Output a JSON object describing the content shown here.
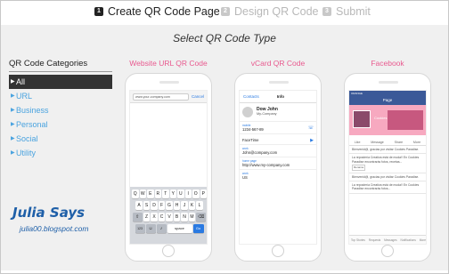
{
  "steps": [
    {
      "num": "1",
      "label": "Create QR Code Page"
    },
    {
      "num": "2",
      "label": "Design QR Code"
    },
    {
      "num": "3",
      "label": "Submit"
    }
  ],
  "page_title": "Select QR Code Type",
  "sidebar": {
    "heading": "QR Code Categories",
    "items": [
      {
        "label": "All"
      },
      {
        "label": "URL"
      },
      {
        "label": "Business"
      },
      {
        "label": "Personal"
      },
      {
        "label": "Social"
      },
      {
        "label": "Utility"
      }
    ]
  },
  "branding": {
    "title": "Julia Says",
    "subtitle": "julia00.blogspot.com"
  },
  "templates": [
    {
      "label": "Website URL QR Code"
    },
    {
      "label": "vCard QR Code"
    },
    {
      "label": "Facebook"
    }
  ],
  "safari": {
    "url": "www.your-company.com",
    "cancel": "Cancel",
    "rows": [
      [
        "Q",
        "W",
        "E",
        "R",
        "T",
        "Y",
        "U",
        "I",
        "O",
        "P"
      ],
      [
        "A",
        "S",
        "D",
        "F",
        "G",
        "H",
        "J",
        "K",
        "L"
      ],
      [
        "Z",
        "X",
        "C",
        "V",
        "B",
        "N",
        "M"
      ]
    ],
    "shift": "⇧",
    "backspace": "⌫",
    "num_key": "123",
    "globe": "☺",
    "mic": "♪",
    "space": "space",
    "slash": "/",
    ".com": ".com",
    "go": "Go"
  },
  "vcard": {
    "nav_back": "Contacts",
    "nav_title": "Info",
    "name": "Dow John",
    "company": "My-Company",
    "fields": [
      {
        "label": "mobile",
        "value": "1234-567-89",
        "icon": "☏"
      },
      {
        "label": "",
        "value": "FaceTime",
        "icon": "▶"
      },
      {
        "label": "work",
        "value": "John@company.com",
        "icon": ""
      },
      {
        "label": "home page",
        "value": "http://www.my-company.com",
        "icon": ""
      },
      {
        "label": "work",
        "value": "US",
        "icon": ""
      }
    ]
  },
  "facebook": {
    "status": "ORANGE",
    "title": "Page",
    "page_name": "Cookies",
    "tabs": [
      "Like",
      "Message",
      "Share",
      "More"
    ],
    "posts": [
      {
        "text": "Bienvenid@, gracias por visitar Cookies Paradise.",
        "button": ""
      },
      {
        "text": "La repostería Creativa está de moda!! En Cookies Paradise encontrarás fotos, recetas...",
        "button": "Rename"
      },
      {
        "text": "Bienvenid@, gracias por visitar Cookies Paradise.",
        "button": ""
      },
      {
        "text": "La repostería Creativa está de moda!! En Cookies Paradise encontrarás fotos...",
        "button": ""
      }
    ],
    "footer": [
      "Top Stories",
      "Requests",
      "Messages",
      "Notifications",
      "More"
    ]
  }
}
